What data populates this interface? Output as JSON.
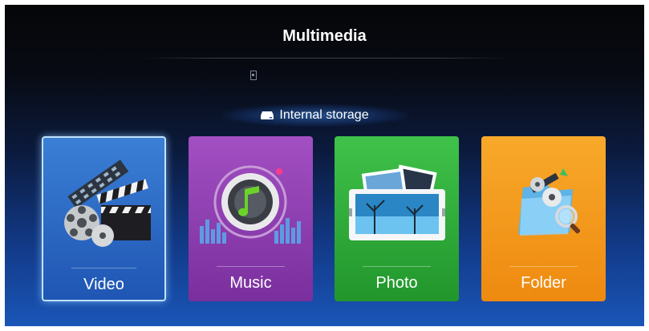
{
  "header": {
    "title": "Multimedia"
  },
  "storage": {
    "label": "Internal storage",
    "icon": "hard-drive-icon",
    "secondary_icon": "usb-drive-icon"
  },
  "tiles": [
    {
      "label": "Video",
      "icon": "film-reel-clapboard-icon",
      "color": "#2f6fcf",
      "selected": true
    },
    {
      "label": "Music",
      "icon": "music-note-disc-icon",
      "color": "#9440b6",
      "selected": false
    },
    {
      "label": "Photo",
      "icon": "photo-frames-icon",
      "color": "#33b03d",
      "selected": false
    },
    {
      "label": "Folder",
      "icon": "folder-search-icon",
      "color": "#f39a1c",
      "selected": false
    }
  ],
  "colors": {
    "accent_focus": "#bfe2ff",
    "background_top": "#050608",
    "background_bottom": "#1a56b8"
  }
}
